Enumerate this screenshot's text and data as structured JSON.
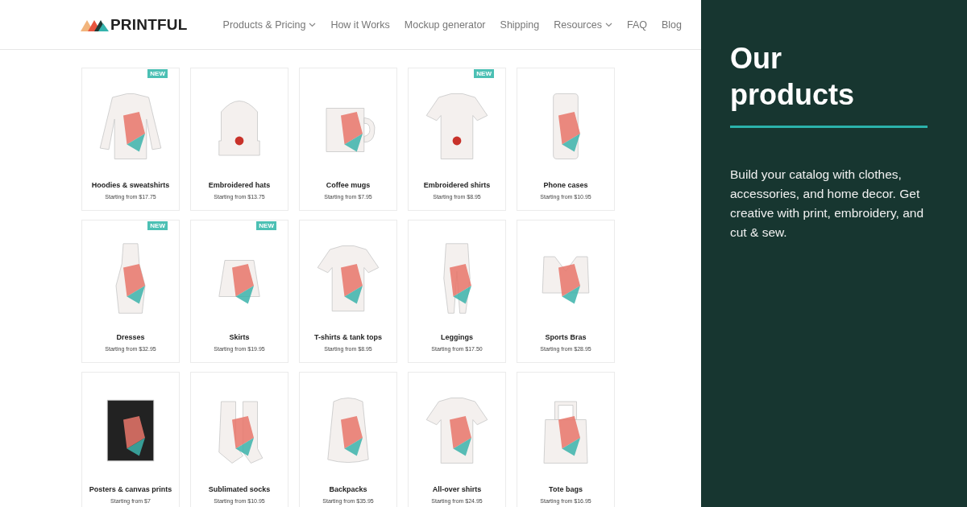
{
  "header": {
    "logo": "PRINTFUL",
    "nav": [
      {
        "label": "Products & Pricing",
        "dropdown": true
      },
      {
        "label": "How it Works",
        "dropdown": false
      },
      {
        "label": "Mockup generator",
        "dropdown": false
      },
      {
        "label": "Shipping",
        "dropdown": false
      },
      {
        "label": "Resources",
        "dropdown": true
      },
      {
        "label": "FAQ",
        "dropdown": false
      },
      {
        "label": "Blog",
        "dropdown": false
      }
    ]
  },
  "products": [
    {
      "name": "Hoodies & sweatshirts",
      "price": "Starting from $17.75",
      "badge": "NEW",
      "kind": "sweatshirt"
    },
    {
      "name": "Embroidered hats",
      "price": "Starting from $13.75",
      "kind": "hat"
    },
    {
      "name": "Coffee mugs",
      "price": "Starting from $7.95",
      "kind": "mug"
    },
    {
      "name": "Embroidered shirts",
      "price": "Starting from $8.95",
      "badge": "NEW",
      "kind": "polo"
    },
    {
      "name": "Phone cases",
      "price": "Starting from $10.95",
      "kind": "phone"
    },
    {
      "name": "Dresses",
      "price": "Starting from $32.95",
      "badge": "NEW",
      "kind": "dress"
    },
    {
      "name": "Skirts",
      "price": "Starting from $19.95",
      "badge": "NEW",
      "kind": "skirt"
    },
    {
      "name": "T-shirts & tank tops",
      "price": "Starting from $8.95",
      "kind": "tshirt"
    },
    {
      "name": "Leggings",
      "price": "Starting from $17.50",
      "kind": "leggings"
    },
    {
      "name": "Sports Bras",
      "price": "Starting from $28.95",
      "kind": "bra"
    },
    {
      "name": "Posters & canvas prints",
      "price": "Starting from $7",
      "kind": "poster"
    },
    {
      "name": "Sublimated socks",
      "price": "Starting from $10.95",
      "kind": "socks"
    },
    {
      "name": "Backpacks",
      "price": "Starting from $35.95",
      "kind": "backpack"
    },
    {
      "name": "All-over shirts",
      "price": "Starting from $24.95",
      "kind": "tshirt"
    },
    {
      "name": "Tote bags",
      "price": "Starting from $16.95",
      "kind": "tote"
    }
  ],
  "panel": {
    "title": "Our products",
    "text": "Build your catalog with clothes, accessories, and home decor. Get creative with print, embroidery, and cut & sew."
  }
}
